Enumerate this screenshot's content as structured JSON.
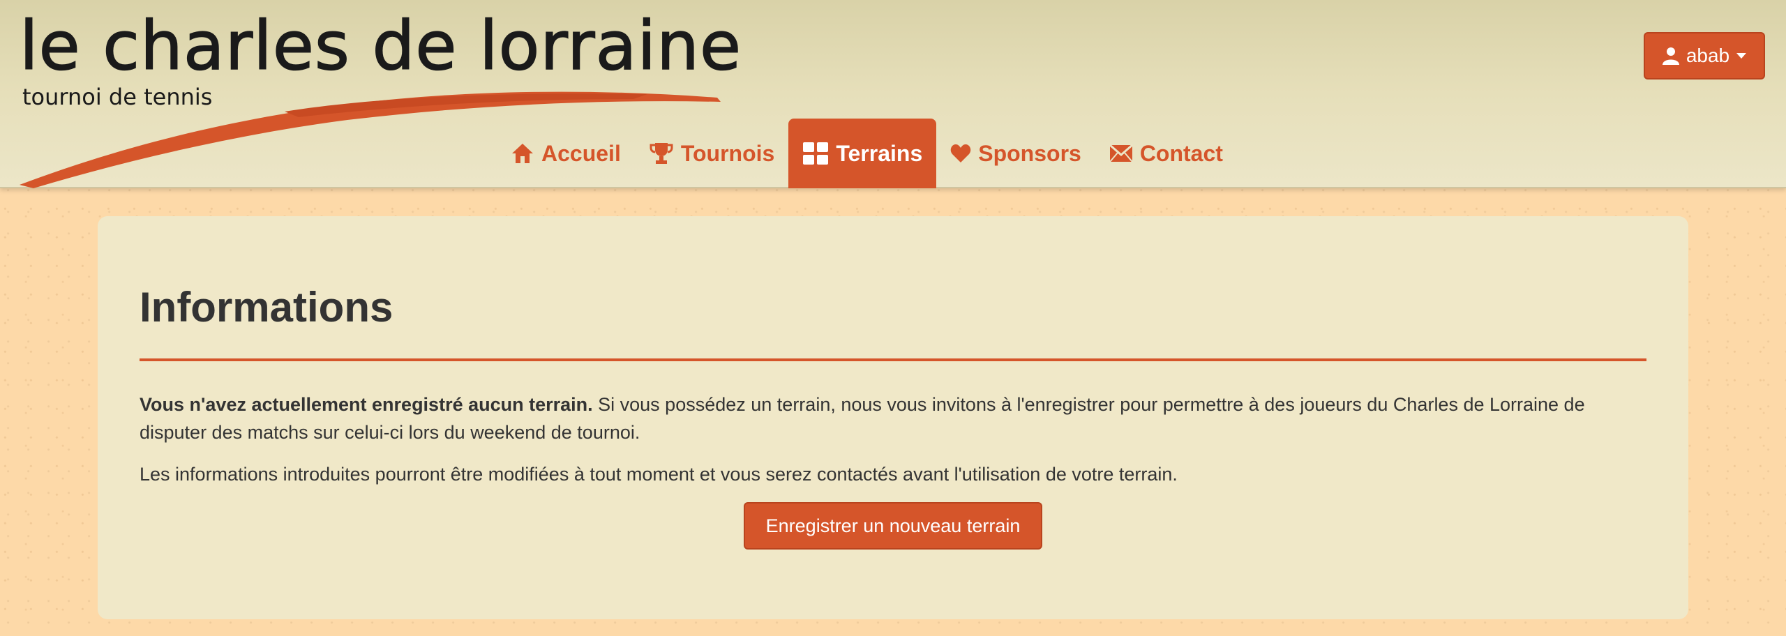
{
  "brand": {
    "title": "le charles de lorraine",
    "subtitle": "tournoi de tennis",
    "accent_color": "#d5552a"
  },
  "user_menu": {
    "username": "abab",
    "icon": "user-icon",
    "caret_icon": "caret-down-icon"
  },
  "nav": {
    "items": [
      {
        "label": "Accueil",
        "icon": "home-icon",
        "active": false
      },
      {
        "label": "Tournois",
        "icon": "trophy-icon",
        "active": false
      },
      {
        "label": "Terrains",
        "icon": "grid-icon",
        "active": true
      },
      {
        "label": "Sponsors",
        "icon": "heart-icon",
        "active": false
      },
      {
        "label": "Contact",
        "icon": "envelope-icon",
        "active": false
      }
    ]
  },
  "main": {
    "heading": "Informations",
    "paragraph1_bold": "Vous n'avez actuellement enregistré aucun terrain.",
    "paragraph1_rest": " Si vous possédez un terrain, nous vous invitons à l'enregistrer pour permettre à des joueurs du Charles de Lorraine de disputer des matchs sur celui-ci lors du weekend de tournoi.",
    "paragraph2": "Les informations introduites pourront être modifiées à tout moment et vous serez contactés avant l'utilisation de votre terrain.",
    "register_button": "Enregistrer un nouveau terrain"
  }
}
